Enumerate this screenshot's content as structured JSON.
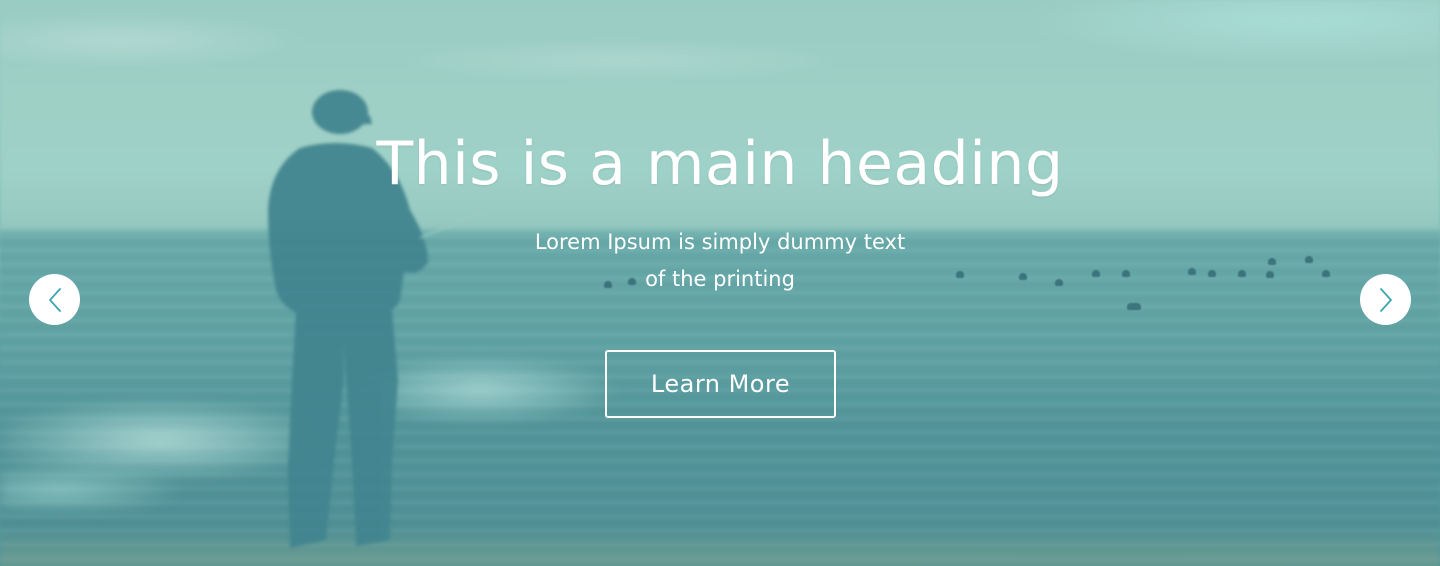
{
  "hero": {
    "heading": "This is a main heading",
    "subtext_line1": "Lorem Ipsum is simply dummy text",
    "subtext_line2": "of the printing",
    "cta_label": "Learn More"
  },
  "slider": {
    "prev_icon": "chevron-left-icon",
    "next_icon": "chevron-right-icon"
  },
  "colors": {
    "accent": "#3aa8b0",
    "text": "#ffffff",
    "overlay_tint": "#7cc2b8"
  }
}
